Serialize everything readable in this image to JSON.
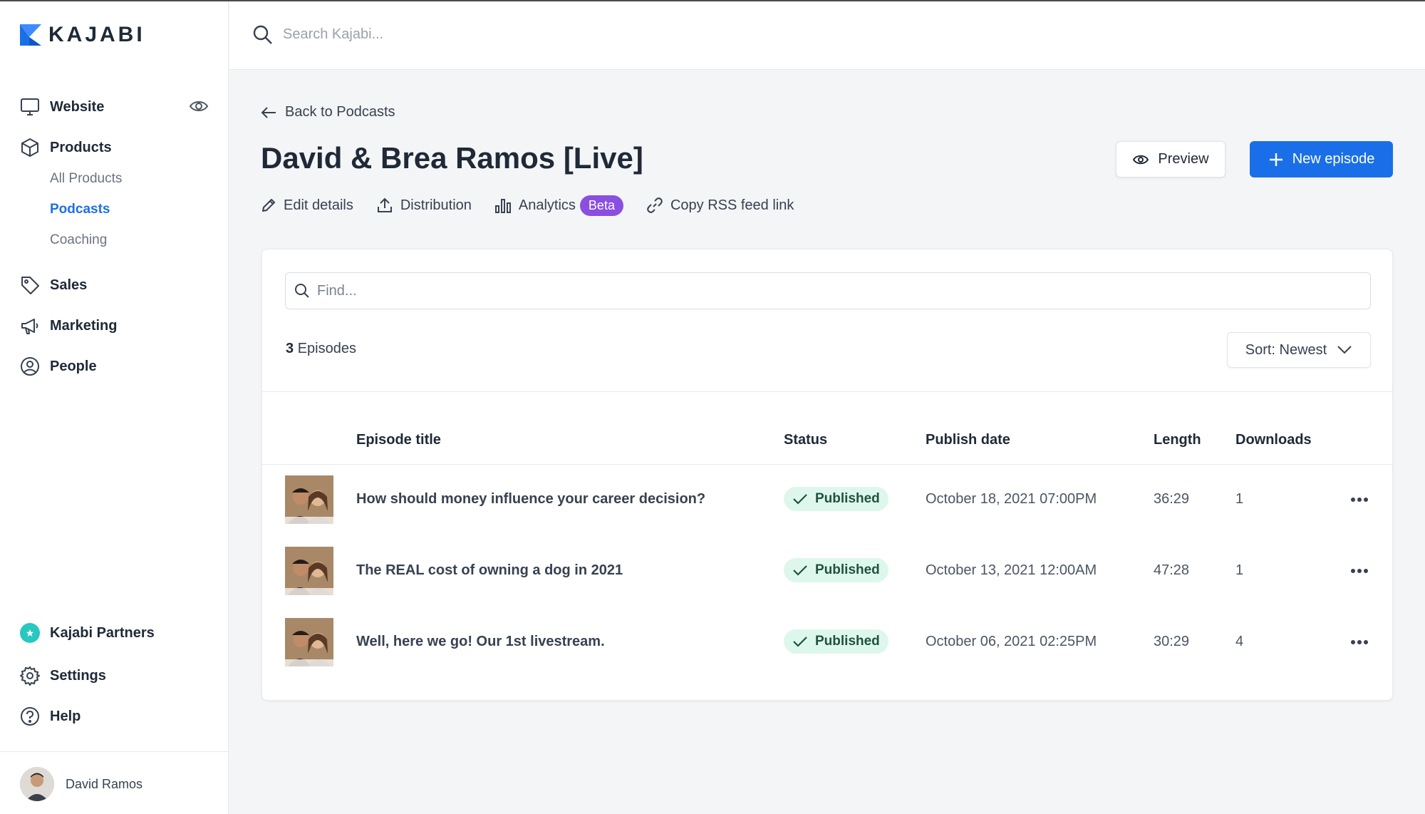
{
  "brand": {
    "name": "KAJABI",
    "accent": "#1a6fe8"
  },
  "search": {
    "placeholder": "Search Kajabi..."
  },
  "sidebar": {
    "items": [
      {
        "label": "Website",
        "icon": "monitor-icon"
      },
      {
        "label": "Products",
        "icon": "box-icon"
      },
      {
        "label": "Sales",
        "icon": "tag-icon"
      },
      {
        "label": "Marketing",
        "icon": "megaphone-icon"
      },
      {
        "label": "People",
        "icon": "user-circle-icon"
      }
    ],
    "product_subitems": [
      "All Products",
      "Podcasts",
      "Coaching"
    ],
    "active_subitem": "Podcasts",
    "bottom_items": [
      {
        "label": "Kajabi Partners",
        "icon": "star-badge-icon"
      },
      {
        "label": "Settings",
        "icon": "gear-icon"
      },
      {
        "label": "Help",
        "icon": "help-circle-icon"
      }
    ],
    "user": {
      "name": "David Ramos"
    }
  },
  "main": {
    "back_label": "Back to Podcasts",
    "title": "David & Brea Ramos [Live]",
    "preview_label": "Preview",
    "new_episode_label": "New episode",
    "actions": {
      "edit": "Edit details",
      "distribution": "Distribution",
      "analytics": "Analytics",
      "beta": "Beta",
      "rss": "Copy RSS feed link"
    },
    "find_placeholder": "Find...",
    "episode_count": "3",
    "episode_count_label": "Episodes",
    "sort_label": "Sort: Newest",
    "columns": {
      "title": "Episode title",
      "status": "Status",
      "publish": "Publish date",
      "length": "Length",
      "downloads": "Downloads"
    },
    "episodes": [
      {
        "title": "How should money influence your career decision?",
        "status": "Published",
        "publish_date": "October 18, 2021 07:00PM",
        "length": "36:29",
        "downloads": "1"
      },
      {
        "title": "The REAL cost of owning a dog in 2021",
        "status": "Published",
        "publish_date": "October 13, 2021 12:00AM",
        "length": "47:28",
        "downloads": "1"
      },
      {
        "title": "Well, here we go! Our 1st livestream.",
        "status": "Published",
        "publish_date": "October 06, 2021 02:25PM",
        "length": "30:29",
        "downloads": "4"
      }
    ]
  }
}
